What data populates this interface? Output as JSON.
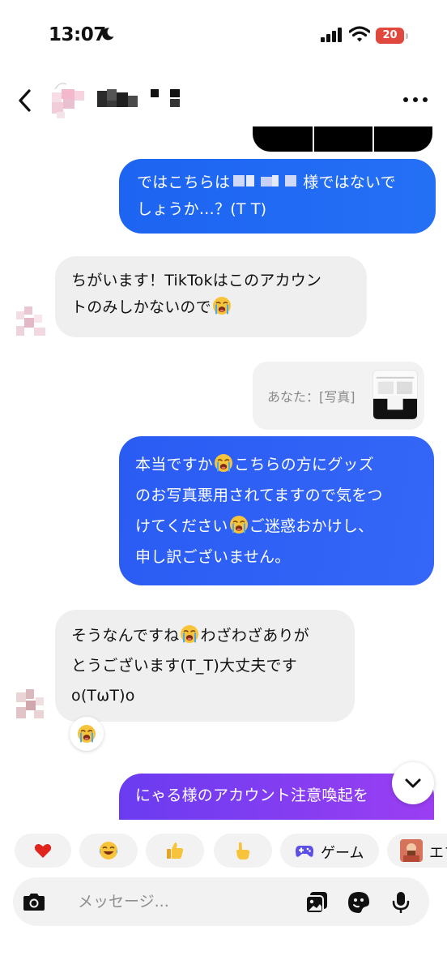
{
  "status_bar": {
    "time": "13:07",
    "battery_level": "20"
  },
  "conversation": {
    "messages": [
      {
        "direction": "outgoing",
        "line1_pre": "ではこちらは",
        "line1_post": "様ではないで",
        "line2": "しょうか…？(T T)"
      },
      {
        "direction": "incoming",
        "line1": "ちがいます！TikTokはこのアカウン",
        "line2": "トのみしかないので"
      },
      {
        "direction": "outgoing_reply",
        "reply_label": "あなた：[写真]"
      },
      {
        "direction": "outgoing",
        "line1_a": "本当ですか",
        "line1_b": "こちらの方にグッズ",
        "line2": "のお写真悪用されてますので気をつ",
        "line3_a": "けてください",
        "line3_b": "ご迷惑おかけし、",
        "line4": "申し訳ございません。"
      },
      {
        "direction": "incoming",
        "line1_a": "そうなんですね",
        "line1_b": "わざわざありが",
        "line2": "とうございます(T_T)大丈夫です",
        "line3": "o(TωT)o"
      },
      {
        "direction": "outgoing",
        "line1": "にゃる様のアカウント注意喚起を"
      }
    ]
  },
  "quick_actions": {
    "game_label": "ゲーム",
    "effects_label": "エフ"
  },
  "composer": {
    "placeholder": "メッセージ..."
  },
  "icons": [
    "back-arrow-icon",
    "more-icon",
    "moon-icon",
    "signal-icon",
    "wifi-icon",
    "battery-icon",
    "crying-emoji-icon",
    "chevron-down-icon",
    "heart-icon",
    "laughing-emoji-icon",
    "thumbs-up-icon",
    "pointing-hand-icon",
    "gamepad-icon",
    "camera-icon",
    "gallery-icon",
    "sticker-icon",
    "mic-icon"
  ],
  "colors": {
    "outgoing_bubble": "#1d64f2",
    "incoming_bubble": "#efefef",
    "accent_purple": "#7b3ff1"
  }
}
